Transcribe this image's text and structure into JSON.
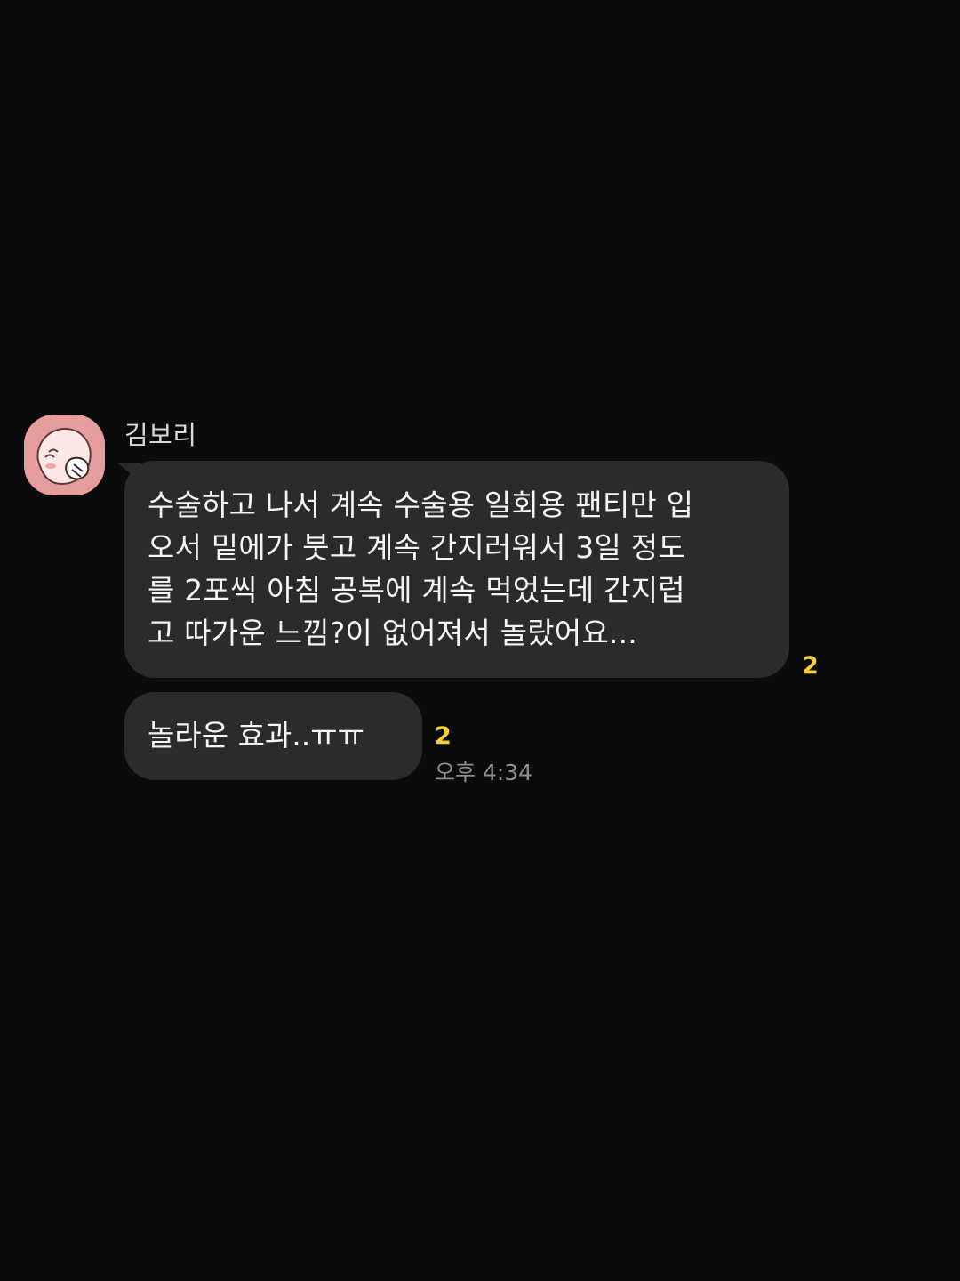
{
  "chat": {
    "sender_name": "김보리",
    "avatar_icon": "peach-character-avatar-icon",
    "accent_unread_color": "#f2d13a",
    "messages": [
      {
        "lines": [
          "수술하고 나서 계속 수술용 일회용 팬티만 입",
          "오서 밑에가 붓고 계속 간지러워서 3일 정도",
          "를 2포씩 아침 공복에 계속 먹었는데 간지럽",
          "고 따가운 느낌?이 없어져서 놀랐어요..."
        ],
        "unread_count": "2"
      },
      {
        "text": "놀라운 효과..ㅠㅠ",
        "unread_count": "2",
        "time": "오후 4:34"
      }
    ]
  }
}
